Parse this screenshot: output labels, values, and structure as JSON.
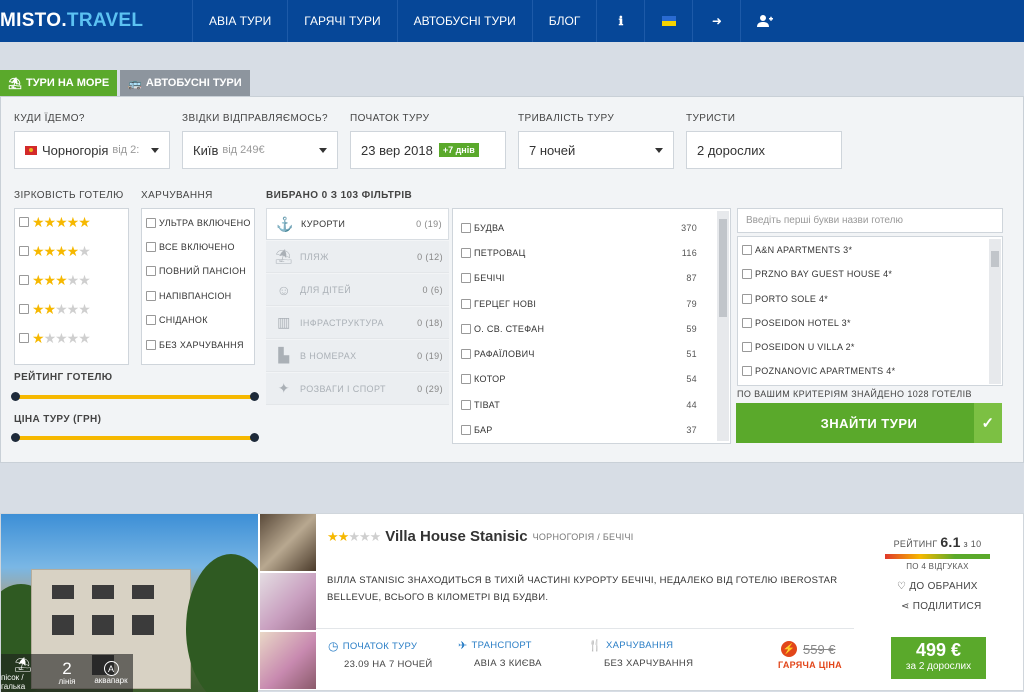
{
  "logo": {
    "main": "MISTO",
    "dot": ".",
    "accent": "TRAVEL"
  },
  "nav": [
    {
      "label": "АВІА ТУРИ"
    },
    {
      "label": "ГАРЯЧІ ТУРИ"
    },
    {
      "label": "АВТОБУСНІ ТУРИ"
    },
    {
      "label": "БЛОГ"
    }
  ],
  "nav_icons": {
    "info": "ℹ",
    "login": "➜",
    "add_user": "+"
  },
  "tabs": {
    "sea": "ТУРИ НА МОРЕ",
    "bus": "АВТОБУСНІ ТУРИ"
  },
  "search": {
    "where_label": "КУДИ ЇДЕМО?",
    "where_value": "Чорногорія",
    "where_sub": "від 2:",
    "from_label": "ЗВІДКИ ВІДПРАВЛЯЄМОСЬ?",
    "from_value": "Київ",
    "from_sub": "від 249€",
    "start_label": "ПОЧАТОК ТУРУ",
    "start_value": "23 вер 2018",
    "start_badge": "+7 днів",
    "duration_label": "ТРИВАЛІСТЬ ТУРУ",
    "duration_value": "7 ночей",
    "tourists_label": "ТУРИСТИ",
    "tourists_value": "2 дорослих"
  },
  "filters": {
    "stars_label": "ЗІРКОВІСТЬ ГОТЕЛЮ",
    "stars": [
      5,
      4,
      3,
      2,
      1
    ],
    "meal_label": "ХАРЧУВАННЯ",
    "meals": [
      "УЛЬТРА ВКЛЮЧЕНО",
      "ВСЕ ВКЛЮЧЕНО",
      "ПОВНИЙ ПАНСІОН",
      "НАПІВПАНСІОН",
      "СНІДАНОК",
      "БЕЗ ХАРЧУВАННЯ"
    ],
    "rating_label": "РЕЙТИНГ ГОТЕЛЮ",
    "price_label": "ЦІНА ТУРУ (ГРН)",
    "selected_label": "ВИБРАНО 0 З 103 ФІЛЬТРІВ",
    "categories": [
      {
        "label": "КУРОРТИ",
        "count": "0 (19)",
        "icon": "⚓"
      },
      {
        "label": "ПЛЯЖ",
        "count": "0 (12)",
        "icon": "⛱"
      },
      {
        "label": "ДЛЯ ДІТЕЙ",
        "count": "0 (6)",
        "icon": "☺"
      },
      {
        "label": "ІНФРАСТРУКТУРА",
        "count": "0 (18)",
        "icon": "▥"
      },
      {
        "label": "В НОМЕРАХ",
        "count": "0 (19)",
        "icon": "▙"
      },
      {
        "label": "РОЗВАГИ І СПОРТ",
        "count": "0 (29)",
        "icon": "✦"
      }
    ],
    "resorts": [
      {
        "name": "БУДВА",
        "count": "370"
      },
      {
        "name": "ПЕТРОВАЦ",
        "count": "116"
      },
      {
        "name": "БЕЧІЧІ",
        "count": "87"
      },
      {
        "name": "ГЕРЦЕГ НОВІ",
        "count": "79"
      },
      {
        "name": "О. СВ. СТЕФАН",
        "count": "59"
      },
      {
        "name": "РАФАЇЛОВИЧ",
        "count": "51"
      },
      {
        "name": "КОТОР",
        "count": "54"
      },
      {
        "name": "ТІВАТ",
        "count": "44"
      },
      {
        "name": "БАР",
        "count": "37"
      }
    ],
    "hotel_placeholder": "Введіть перші букви назви готелю",
    "hotels": [
      "A&N APARTMENTS 3*",
      "PRZNO BAY GUEST HOUSE 4*",
      "PORTO SOLE 4*",
      "POSEIDON HOTEL 3*",
      "POSEIDON U VILLA 2*",
      "POZNANOVIC APARTMENTS 4*"
    ],
    "found_text": "ПО ВАШИМ КРИТЕРІЯМ ЗНАЙДЕНО 1028 ГОТЕЛІВ",
    "find_button": "ЗНАЙТИ ТУРИ"
  },
  "hotel_card": {
    "stars": 2,
    "name": "Villa House Stanisic",
    "location": "ЧОРНОГОРІЯ / БЕЧІЧІ",
    "description": "ВІЛЛА STANISIC ЗНАХОДИТЬСЯ В ТИХІЙ ЧАСТИНІ КУРОРТУ БЕЧІЧІ, НЕДАЛЕКО ВІД ГОТЕЛЮ IBEROSTAR BELLEVUE, ВСЬОГО В КІЛОМЕТРІ ВІД БУДВИ.",
    "beach_label": "пісок / галька",
    "line_value": "2",
    "line_label": "лінія",
    "aqua_icon": "A",
    "aqua_label": "аквапарк",
    "start_h": "ПОЧАТОК ТУРУ",
    "start_v": "23.09 НА 7 НОЧЕЙ",
    "transport_h": "ТРАНСПОРТ",
    "transport_v": "АВІА З КИЄВА",
    "meal_h": "ХАРЧУВАННЯ",
    "meal_v": "БЕЗ ХАРЧУВАННЯ",
    "rating_label": "РЕЙТИНГ",
    "rating_value": "6.1",
    "rating_of": "з 10",
    "reviews": "ПО 4 ВІДГУКАХ",
    "fav": "ДО ОБРАНИХ",
    "share": "ПОДІЛИТИСЯ",
    "old_price": "559 €",
    "hot_label": "ГАРЯЧА ЦІНА",
    "price": "499 €",
    "price_for": "за 2 дорослих"
  },
  "colors": {
    "brand": "#064798",
    "accent": "#5aa92b",
    "star": "#f6b800",
    "hot": "#e2461a"
  }
}
